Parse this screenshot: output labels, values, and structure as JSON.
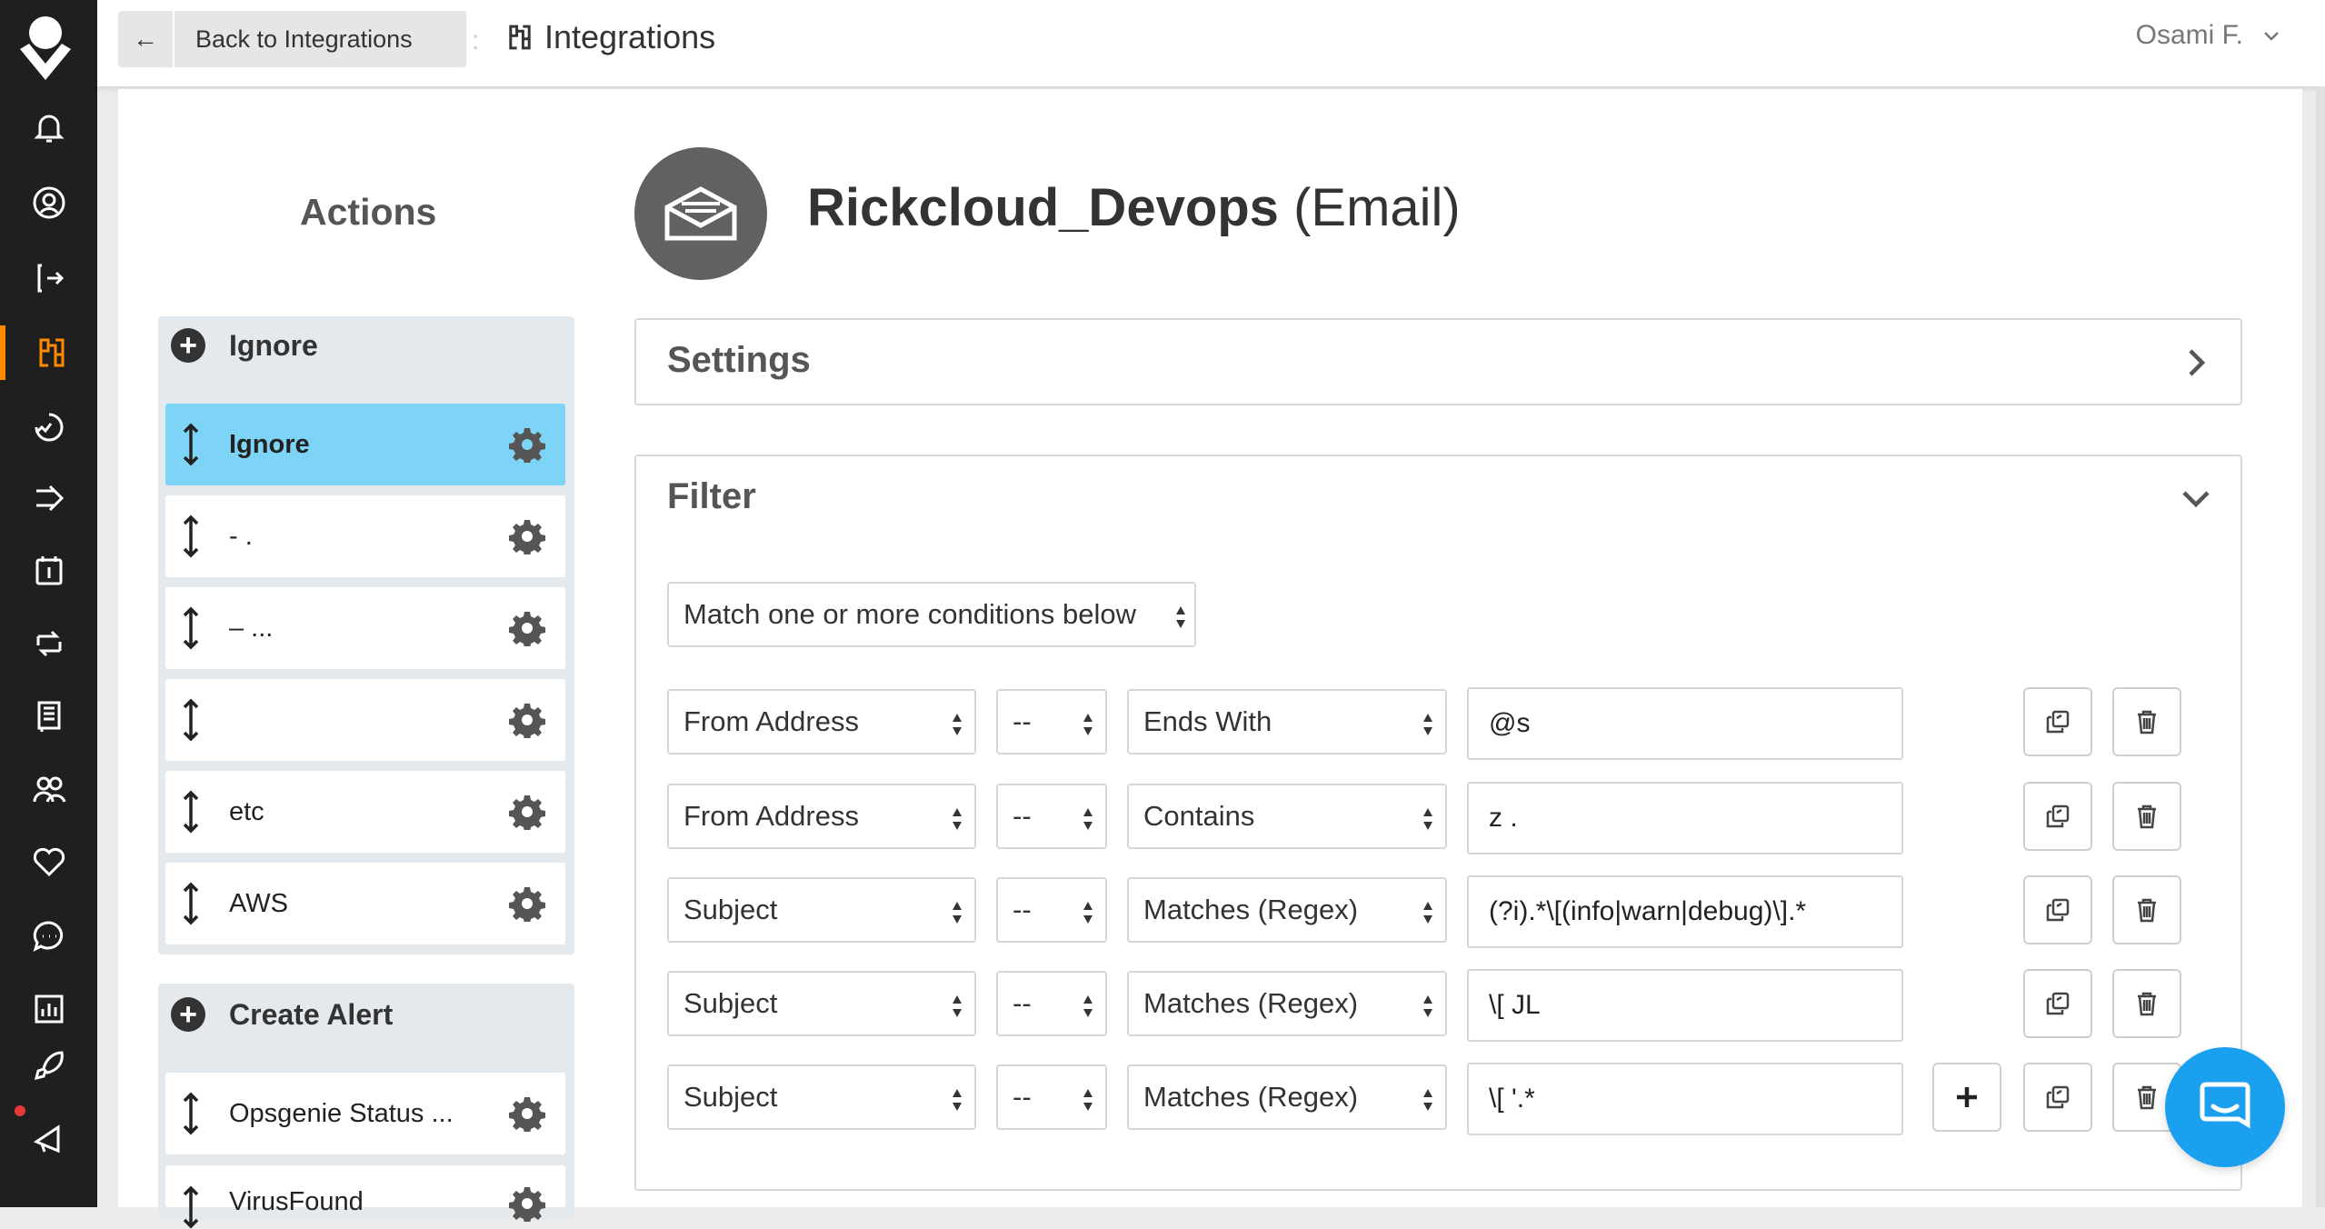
{
  "topbar": {
    "back_label": "Back to Integrations",
    "back_icon": "arrow-left-icon",
    "title": "Integrations",
    "title_icon": "integrations-icon",
    "user_name": "Osami F."
  },
  "nav": {
    "accent_color": "#ff8a00",
    "items": [
      "bell-icon",
      "user-circle-icon",
      "phone-forward-icon",
      "integrations-icon",
      "heartbeat-icon",
      "routing-icon",
      "calendar-icon",
      "policy-icon",
      "book-icon",
      "teams-icon",
      "heart-icon",
      "chat-icon",
      "reports-icon",
      "rocket-icon",
      "megaphone-icon"
    ],
    "active": "integrations-icon"
  },
  "actions": {
    "title": "Actions",
    "groups": [
      {
        "label": "Ignore",
        "rules": [
          {
            "name": "Ignore",
            "selected": true
          },
          {
            "name": "- .",
            "selected": false
          },
          {
            "name": "– ...",
            "selected": false
          },
          {
            "name": "",
            "selected": false
          },
          {
            "name": "etc",
            "selected": false
          },
          {
            "name": "AWS",
            "selected": false
          }
        ]
      },
      {
        "label": "Create Alert",
        "rules": [
          {
            "name": "Opsgenie Status ...",
            "selected": false
          },
          {
            "name": "VirusFound",
            "selected": false
          }
        ]
      }
    ]
  },
  "integration": {
    "name": "Rickcloud_Devops",
    "type": "(Email)"
  },
  "settings": {
    "title": "Settings"
  },
  "filter": {
    "title": "Filter",
    "match_mode": "Match one or more conditions below",
    "conditions": [
      {
        "field": "From Address",
        "not": "--",
        "operation": "Ends With",
        "value": "@s"
      },
      {
        "field": "From Address",
        "not": "--",
        "operation": "Contains",
        "value": "z                         ."
      },
      {
        "field": "Subject",
        "not": "--",
        "operation": "Matches (Regex)",
        "value": "(?i).*\\[(info|warn|debug)\\].*"
      },
      {
        "field": "Subject",
        "not": "--",
        "operation": "Matches (Regex)",
        "value": "\\[                                          JL"
      },
      {
        "field": "Subject",
        "not": "--",
        "operation": "Matches (Regex)",
        "value": "\\[                                          '.*"
      }
    ]
  }
}
